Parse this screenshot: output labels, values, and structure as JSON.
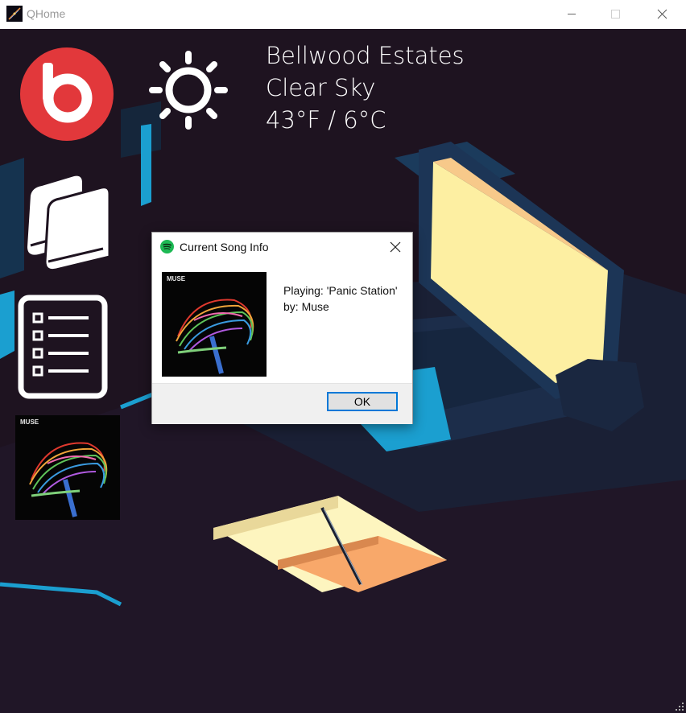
{
  "window": {
    "title": "QHome",
    "icons": {
      "app": "qhome-app-icon",
      "minimize": "minimize-icon",
      "maximize": "maximize-icon",
      "close": "close-icon"
    }
  },
  "weather": {
    "location": "Bellwood Estates",
    "condition": "Clear Sky",
    "temperature": "43°F / 6°C",
    "icon": "sun-icon"
  },
  "tiles": [
    {
      "name": "beats-music-tile",
      "icon": "beats-logo-icon"
    },
    {
      "name": "weather-tile",
      "icon": "sun-icon"
    },
    {
      "name": "library-tile",
      "icon": "books-icon"
    },
    {
      "name": "tasks-tile",
      "icon": "checklist-icon"
    },
    {
      "name": "now-playing-tile",
      "icon": "album-art-icon"
    }
  ],
  "album_art": {
    "wordmark": "MUSE"
  },
  "dialog": {
    "title": "Current Song Info",
    "icon": "spotify-icon",
    "message_line1": "Playing: 'Panic Station'",
    "message_line2": "by: Muse",
    "ok_label": "OK"
  },
  "colors": {
    "background": "#1e1320",
    "beats_red": "#e2383b",
    "screen_glow": "#fdefa2",
    "laptop_blue": "#1b9fd0",
    "spotify_green": "#1db954",
    "focus_blue": "#0078d7"
  }
}
